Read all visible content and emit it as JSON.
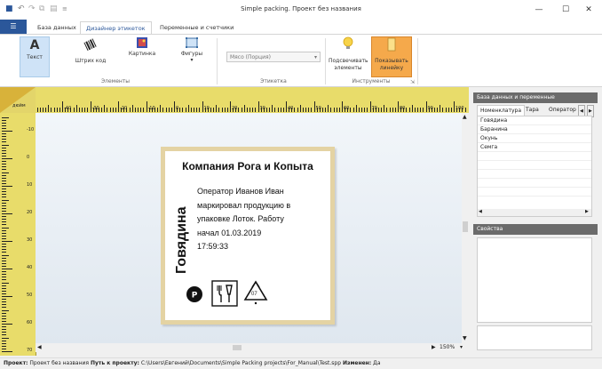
{
  "window": {
    "title": "Simple packing. Проект без названия",
    "minimize_glyph": "—",
    "maximize_glyph": "☐",
    "close_glyph": "✕"
  },
  "ribbon_tabs": [
    {
      "label": "База данных",
      "active": false
    },
    {
      "label": "Дизайнер этикеток",
      "active": true
    },
    {
      "label": "Переменные и счетчики",
      "active": false
    }
  ],
  "ribbon": {
    "elements": {
      "group_label": "Элементы",
      "text_label": "Текст",
      "barcode_label": "Штрих код",
      "picture_label": "Картинка",
      "shapes_label": "Фигуры"
    },
    "label_group": {
      "group_label": "Этикетка",
      "combo_value": "Мясо (Порция)"
    },
    "tools": {
      "group_label": "Инструменты",
      "highlight_label": "Подсвечивать элементы",
      "ruler_label": "Показывать линейку"
    }
  },
  "ruler": {
    "unit": "дюйм",
    "h_marks": [
      "-40",
      "-30",
      "-20",
      "-10",
      "0",
      "10",
      "20",
      "30",
      "40",
      "50",
      "60",
      "70",
      "80",
      "90",
      "100"
    ],
    "v_marks": [
      "-10",
      "0",
      "10",
      "20",
      "30",
      "40",
      "50",
      "60",
      "70"
    ]
  },
  "label": {
    "company": "Компания Рога и Копыта",
    "body": "Оператор Иванов Иван\nмаркировал продукцию в\nупаковке Лоток. Работу\nначал 01.03.2019\n17:59:33",
    "vertical": "Говядина",
    "recycle_number": "07"
  },
  "zoom": "150%",
  "right_panel": {
    "db_header": "База данных и переменные",
    "tabs": [
      "Номенклатура",
      "Тара",
      "Оператор"
    ],
    "items": [
      "Говядина",
      "Баранина",
      "Окунь",
      "Семга"
    ],
    "props_header": "Свойства"
  },
  "status": {
    "project_label": "Проект:",
    "project_value": "Проект без названия",
    "path_label": "Путь к проекту:",
    "path_value": "C:\\Users\\Евгений\\Documents\\Simple Packing projects\\For_Manual\\Test.spp",
    "changed_label": "Изменен:",
    "changed_value": "Да"
  },
  "colors": {
    "accent": "#2b579a",
    "ruler": "#e8dc6a",
    "label_frame": "#e4d3a3",
    "active_button": "#f5a94b"
  }
}
